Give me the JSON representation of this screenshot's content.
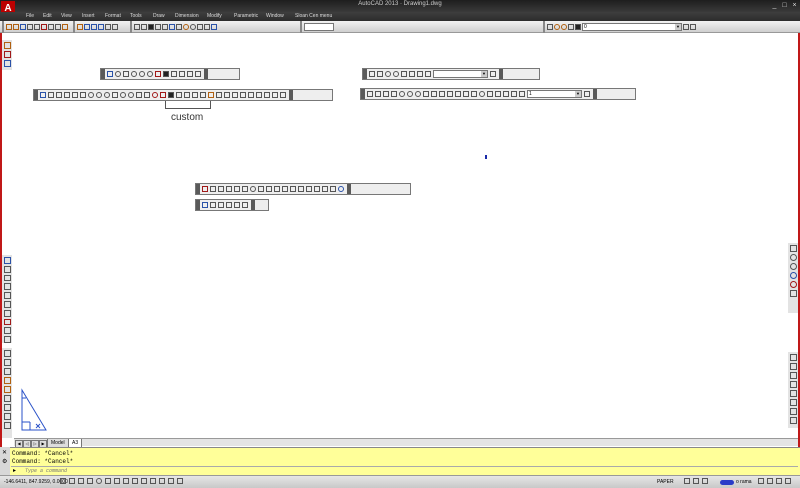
{
  "app": {
    "title": "AutoCAD 2013 · Drawing1.dwg",
    "icon_letter": "A",
    "window_controls": [
      "_",
      "□",
      "×"
    ]
  },
  "menu": {
    "items": [
      "File",
      "Edit",
      "View",
      "Insert",
      "Format",
      "Tools",
      "Draw",
      "Dimension",
      "Modify",
      "Parametric",
      "Window",
      "Sloan Cen menu"
    ]
  },
  "toolbar": {
    "layer_value": "0",
    "dimstyle_value": "1"
  },
  "label": {
    "custom": "custom"
  },
  "tabs": {
    "items": [
      "Model",
      "A3"
    ],
    "active": "A3"
  },
  "command": {
    "history": [
      "Command: *Cancel*",
      "Command: *Cancel*"
    ],
    "placeholder": "Type a command"
  },
  "status": {
    "coordinates": "-146.6411, 847.9259, 0.0000",
    "space": "PAPER",
    "annotation_scale": "o rama"
  },
  "colors": {
    "accent": "#c01818",
    "command_bg": "#ffff99",
    "ucs_blue": "#2a52c8"
  },
  "icons": {
    "app": "autocad-logo-icon",
    "ucs": "ucs-icon"
  }
}
